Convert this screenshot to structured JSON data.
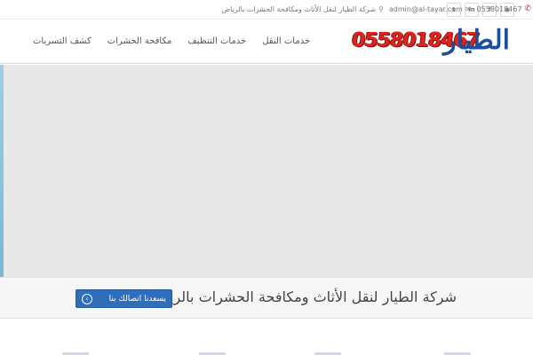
{
  "topbar": {
    "social": [
      {
        "icon": "rss-icon",
        "glyph": "◉"
      },
      {
        "icon": "facebook-icon",
        "glyph": "f"
      },
      {
        "icon": "linkedin-icon",
        "glyph": "in"
      },
      {
        "icon": "twitter-icon",
        "glyph": "t"
      }
    ],
    "phone": "0558018467",
    "email": "admin@al-tayar.com",
    "address": "شركة الطيار لنقل الأثاث ومكافحة الحشرات بالرياض"
  },
  "header": {
    "logo_text": "الطيار",
    "logo_phone": "0558018467",
    "nav": [
      "خدمات النقل",
      "خدمات التنظيف",
      "مكافحة الحشرات",
      "كشف التسربات"
    ]
  },
  "callout": {
    "title": "شركة الطيار لنقل الأثاث ومكافحة الحشرات بالرياض",
    "button_label": "يسعدنا اتصالك بنا",
    "button_icon": "arrow-left-circle-icon"
  },
  "colors": {
    "accent": "#2f6ebb",
    "logo_blue": "#1d4e9e",
    "logo_red": "#e0231d",
    "hero_bg": "#e8e8e8"
  }
}
